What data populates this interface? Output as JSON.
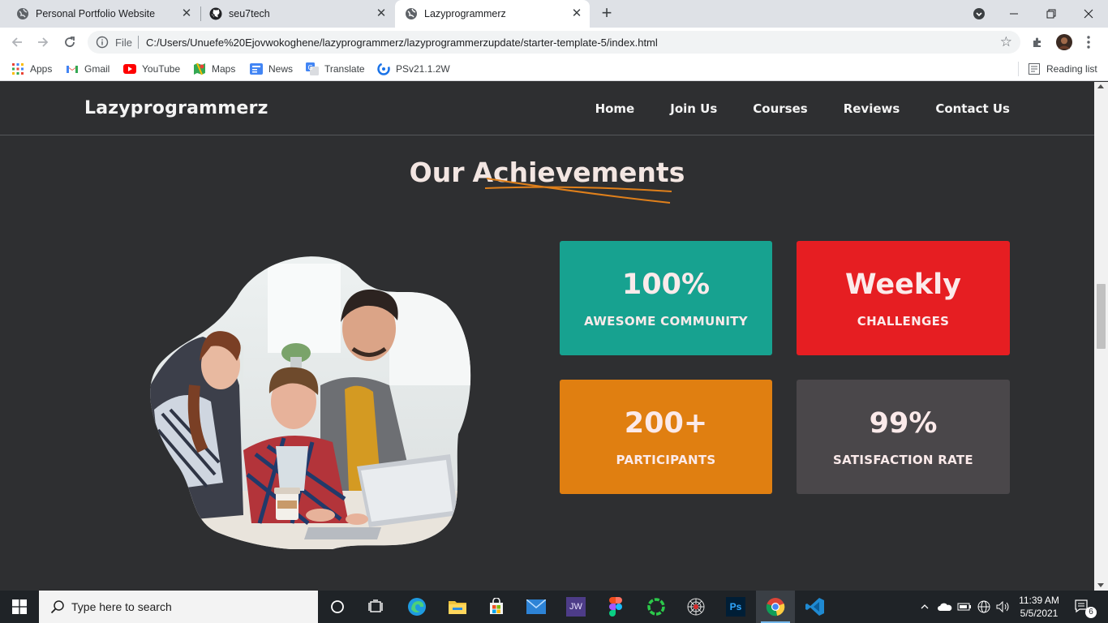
{
  "browser": {
    "tabs": [
      {
        "title": "Personal Portfolio Website",
        "icon": "globe-icon"
      },
      {
        "title": "seu7tech",
        "icon": "github-icon"
      },
      {
        "title": "Lazyprogrammerz",
        "icon": "globe-icon",
        "active": true
      }
    ],
    "address": {
      "file_label": "File",
      "url": "C:/Users/Unuefe%20Ejovwokoghene/lazyprogrammerz/lazyprogrammerzupdate/starter-template-5/index.html"
    },
    "bookmarks": [
      {
        "label": "Apps",
        "icon": "apps-grid-icon"
      },
      {
        "label": "Gmail",
        "icon": "gmail-icon"
      },
      {
        "label": "YouTube",
        "icon": "youtube-icon"
      },
      {
        "label": "Maps",
        "icon": "maps-icon"
      },
      {
        "label": "News",
        "icon": "news-icon"
      },
      {
        "label": "Translate",
        "icon": "translate-icon"
      },
      {
        "label": "PSv21.1.2W",
        "icon": "bookmark-favicon-icon"
      }
    ],
    "reading_list": "Reading list"
  },
  "site": {
    "brand": "Lazyprogrammerz",
    "nav": [
      "Home",
      "Join Us",
      "Courses",
      "Reviews",
      "Contact Us"
    ],
    "section_title_part1": "Our",
    "section_title_part2": "Achievements",
    "accent_color": "#e0801b",
    "cards": [
      {
        "value": "100%",
        "label": "AWESOME COMMUNITY",
        "color": "#17a290"
      },
      {
        "value": "Weekly",
        "label": "CHALLENGES",
        "color": "#e61e22"
      },
      {
        "value": "200+",
        "label": "PARTICIPANTS",
        "color": "#e07f11"
      },
      {
        "value": "99%",
        "label": "SATISFACTION RATE",
        "color": "#4a474a"
      }
    ]
  },
  "taskbar": {
    "search_placeholder": "Type here to search",
    "time": "11:39 AM",
    "date": "5/5/2021",
    "notification_count": "6",
    "pinned": [
      "cortana-icon",
      "task-view-icon",
      "edge-icon",
      "file-explorer-icon",
      "store-icon",
      "mail-icon",
      "jw-app-icon",
      "figma-icon",
      "loading-ring-app-icon",
      "spider-web-app-icon",
      "photoshop-icon",
      "chrome-icon",
      "vscode-icon"
    ],
    "jw_label": "JW",
    "ps_label": "Ps"
  }
}
